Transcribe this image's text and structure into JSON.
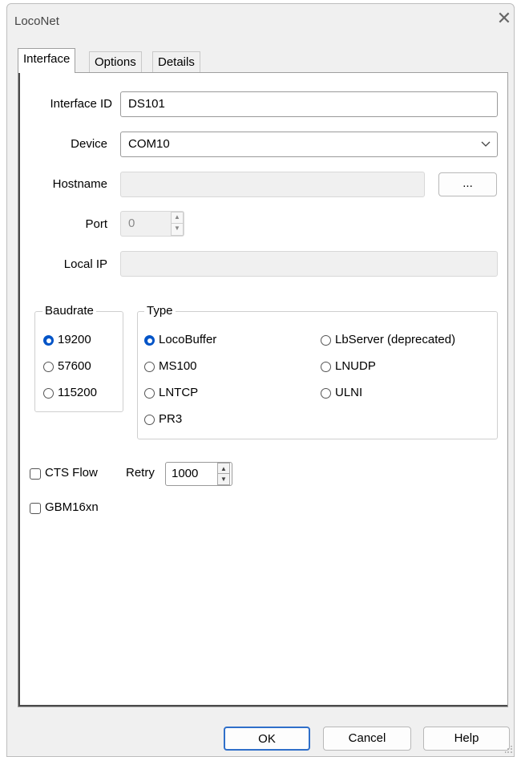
{
  "window": {
    "title": "LocoNet",
    "close_glyph": "✕"
  },
  "tabs": [
    {
      "label": "Interface",
      "active": true
    },
    {
      "label": "Options",
      "active": false
    },
    {
      "label": "Details",
      "active": false
    }
  ],
  "interface": {
    "interface_id_label": "Interface ID",
    "interface_id_value": "DS101",
    "device_label": "Device",
    "device_value": "COM10",
    "hostname_label": "Hostname",
    "hostname_value": "",
    "browse_label": "...",
    "port_label": "Port",
    "port_value": "0",
    "local_ip_label": "Local IP",
    "local_ip_value": ""
  },
  "baudrate": {
    "legend": "Baudrate",
    "options": [
      "19200",
      "57600",
      "115200"
    ],
    "selected": "19200"
  },
  "type": {
    "legend": "Type",
    "options_left": [
      "LocoBuffer",
      "MS100",
      "LNTCP",
      "PR3"
    ],
    "options_right": [
      "LbServer (deprecated)",
      "LNUDP",
      "ULNI"
    ],
    "selected": "LocoBuffer"
  },
  "flags": {
    "cts_flow_label": "CTS Flow",
    "cts_flow_checked": false,
    "retry_label": "Retry",
    "retry_value": "1000",
    "gbm16xn_label": "GBM16xn",
    "gbm16xn_checked": false
  },
  "buttons": {
    "ok": "OK",
    "cancel": "Cancel",
    "help": "Help"
  },
  "colors": {
    "accent": "#0054c7",
    "window_bg": "#f0f0f0",
    "panel_bg": "#ffffff"
  },
  "icons": {
    "dropdown": "chevron-down-icon",
    "spin_up": "spin-up-icon",
    "spin_down": "spin-down-icon",
    "close": "close-icon"
  }
}
